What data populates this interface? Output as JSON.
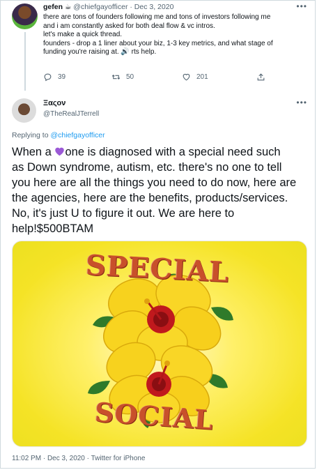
{
  "parent_tweet": {
    "name": "gefen",
    "name_emoji": "☕",
    "handle": "@chiefgayofficer",
    "date": "Dec 3, 2020",
    "text_lines": [
      "there are tons of founders following me and tons of investors following me",
      "and i am constantly asked for both deal flow & vc intros.",
      "let's make a quick thread.",
      "founders - drop a 1 liner about your biz, 1-3 key metrics, and what stage of",
      "funding you're raising at. 🔊 rts help."
    ],
    "replies": "39",
    "retweets": "50",
    "likes": "201",
    "more": "•••"
  },
  "main_tweet": {
    "name": "Ξαςον",
    "handle": "@TheRealJTerrell",
    "more": "•••",
    "replying_prefix": "Replying to",
    "replying_to": "@chiefgayofficer",
    "text_lines": [
      "one is diagnosed with a special need such",
      "as Down syndrome, autism, etc. there's no one to tell",
      "you here are all the things you need to do now, here are",
      "the agencies, here are the benefits, products/services.",
      "No, it's just U to figure it out. We are here to",
      "help!$500BTAM"
    ],
    "text_prefix": "When a",
    "image_words": {
      "top": "SPECIAL",
      "bottom": "SOCIAL"
    },
    "footer": "11:02 PM · Dec 3, 2020 · Twitter for iPhone"
  },
  "colors": {
    "link": "#1d9bf0",
    "muted": "#536471",
    "heart": "#9b59d6"
  }
}
